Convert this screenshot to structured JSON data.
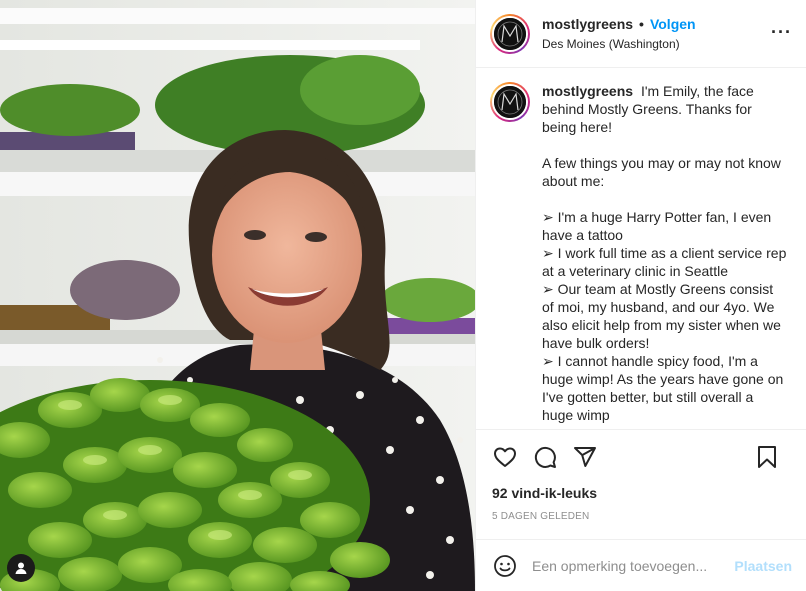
{
  "post": {
    "username": "mostlygreens",
    "follow_label": "Volgen",
    "separator": "•",
    "location": "Des Moines (Washington)",
    "more_icon": "···",
    "caption": {
      "username": "mostlygreens",
      "intro": "I'm Emily, the face behind Mostly Greens. Thanks for being here!",
      "lead": "A few things you may or may not know about me:",
      "bullets": [
        "➢ I'm a huge Harry Potter fan, I even have a tattoo",
        "➢ I work full time as a client service rep at a veterinary clinic in Seattle",
        "➢ Our team at Mostly Greens consist of moi, my husband, and our 4yo. We also elicit help from my sister when we have bulk orders!",
        "➢ I cannot handle spicy food, I'm a huge wimp! As the years have gone on I've gotten better, but still overall a huge wimp"
      ]
    },
    "likes": "92 vind-ik-leuks",
    "date": "5 DAGEN GELEDEN",
    "comment": {
      "placeholder": "Een opmerking toevoegen...",
      "post_label": "Plaatsen"
    },
    "icons": {
      "like": "heart-icon",
      "comment": "comment-icon",
      "share": "share-icon",
      "save": "bookmark-icon",
      "emoji": "emoji-icon",
      "tag": "user-tag-icon"
    },
    "colors": {
      "accent": "#0095f6",
      "post_disabled": "#b2dffc",
      "muted": "#8e8e8e"
    }
  }
}
